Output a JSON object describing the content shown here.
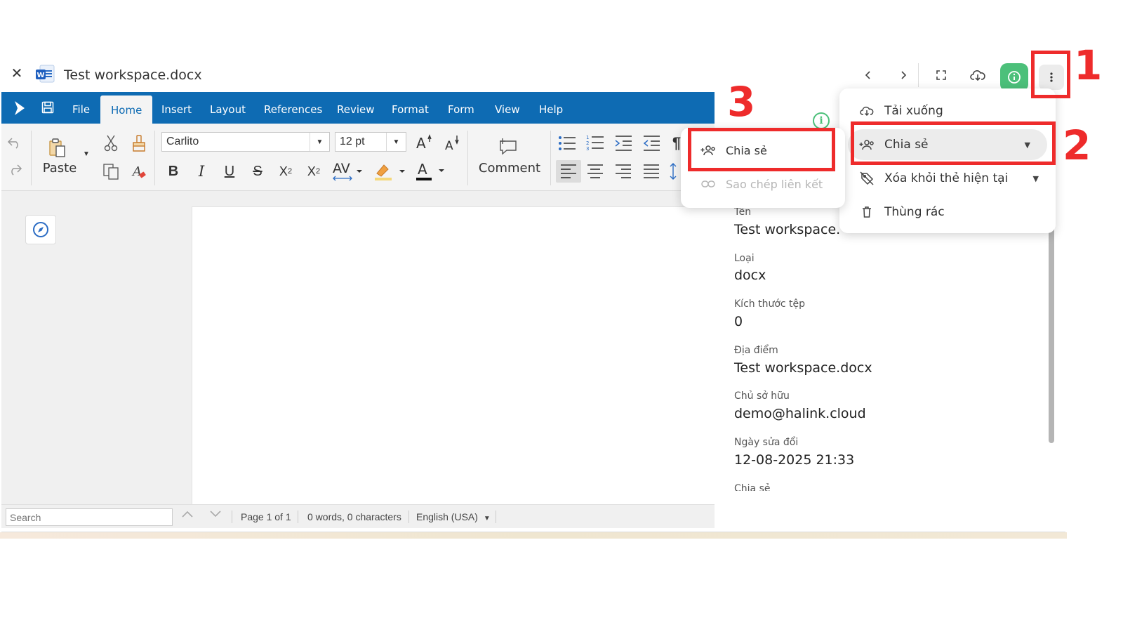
{
  "titlebar": {
    "document_title": "Test workspace.docx"
  },
  "ribbon": {
    "tabs": [
      "File",
      "Home",
      "Insert",
      "Layout",
      "References",
      "Review",
      "Format",
      "Form",
      "View",
      "Help"
    ],
    "active_tab": "Home",
    "paste_label": "Paste",
    "font_name": "Carlito",
    "font_size": "12 pt",
    "comment_label": "Comment"
  },
  "statusbar": {
    "search_placeholder": "Search",
    "page_info": "Page 1 of 1",
    "word_count": "0 words, 0 characters",
    "language": "English (USA)"
  },
  "info_panel": {
    "properties": [
      {
        "label": "Tên",
        "value": "Test workspace."
      },
      {
        "label": "Loại",
        "value": "docx"
      },
      {
        "label": "Kích thước tệp",
        "value": "0"
      },
      {
        "label": "Địa điểm",
        "value": "Test workspace.docx"
      },
      {
        "label": "Chủ sở hữu",
        "value": "demo@halink.cloud"
      },
      {
        "label": "Ngày sửa đổi",
        "value": "12-08-2025 21:33"
      },
      {
        "label": "Chia sẻ",
        "value": ""
      }
    ]
  },
  "main_menu": {
    "items": [
      {
        "label": "Tải xuống",
        "icon": "cloud-download-icon"
      },
      {
        "label": "Chia sẻ",
        "icon": "share-users-icon"
      },
      {
        "label": "Xóa khỏi thẻ hiện tại",
        "icon": "tag-remove-icon"
      },
      {
        "label": "Thùng rác",
        "icon": "trash-icon"
      }
    ]
  },
  "share_submenu": {
    "items": [
      {
        "label": "Chia sẻ",
        "icon": "add-user-icon"
      },
      {
        "label": "Sao chép liên kết",
        "icon": "link-icon"
      }
    ]
  },
  "annotations": {
    "step1": "1",
    "step2": "2",
    "step3": "3"
  },
  "colors": {
    "ribbon_blue": "#0e6bb3",
    "info_green": "#4cc07a",
    "annotation_red": "#ee2b2b"
  }
}
